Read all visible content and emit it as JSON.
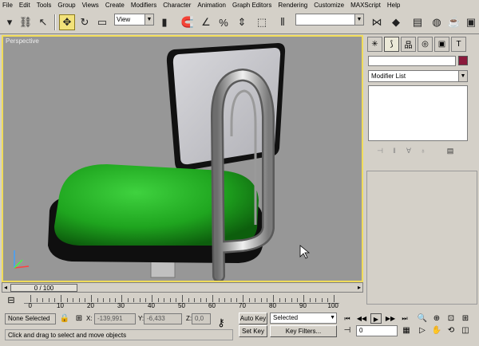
{
  "menu": [
    "File",
    "Edit",
    "Tools",
    "Group",
    "Views",
    "Create",
    "Modifiers",
    "Character",
    "Animation",
    "Graph Editors",
    "Rendering",
    "Customize",
    "MAXScript",
    "Help"
  ],
  "toolbar": {
    "ref_coord": "View",
    "named_selection": ""
  },
  "viewport": {
    "label": "Perspective"
  },
  "command_panel": {
    "modifier_list": "Modifier List"
  },
  "time": {
    "slider": "0 / 100",
    "ticks": [
      "0",
      "10",
      "20",
      "30",
      "40",
      "50",
      "60",
      "70",
      "80",
      "90",
      "100"
    ]
  },
  "status": {
    "selection": "None Selected",
    "x_label": "X:",
    "x_value": "-139,991",
    "y_label": "Y:",
    "y_value": "-6,433",
    "z_label": "Z:",
    "z_value": "0,0",
    "auto_key": "Auto Key",
    "set_key": "Set Key",
    "key_mode": "Selected",
    "key_filters": "Key Filters...",
    "frame": "0",
    "prompt": "Click and drag to select and move objects"
  },
  "colors": {
    "viewport_bg": "#979797",
    "viewport_border": "#f0dc5a",
    "seat": "#1fa51f",
    "object_color": "#8b1a3c"
  }
}
